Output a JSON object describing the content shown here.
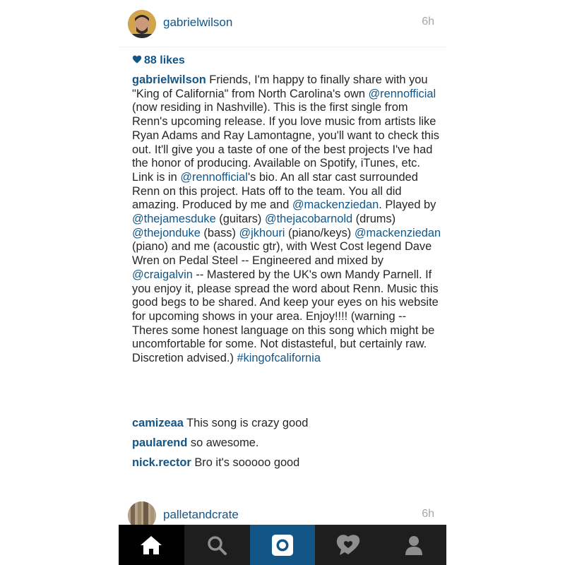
{
  "post": {
    "username": "gabrielwilson",
    "time": "6h",
    "likes": "88 likes",
    "caption_segments": [
      {
        "t": "user",
        "v": "gabrielwilson"
      },
      {
        "t": "text",
        "v": " Friends, I'm happy to finally share with you \"King of California\" from North Carolina's own "
      },
      {
        "t": "mention",
        "v": "@rennofficial"
      },
      {
        "t": "text",
        "v": " (now residing in Nashville). This is the first single from Renn's upcoming release. If you love music from artists like Ryan Adams and Ray Lamontagne, you'll want to check this out. It'll give you a taste of one of the best projects I've had the honor of producing.  Available on Spotify, iTunes, etc. Link is in "
      },
      {
        "t": "mention",
        "v": "@rennofficial"
      },
      {
        "t": "text",
        "v": "'s bio.  An all star cast surrounded Renn on this project. Hats off to the team. You all did amazing. Produced by me and "
      },
      {
        "t": "mention",
        "v": "@mackenziedan"
      },
      {
        "t": "text",
        "v": ". Played by "
      },
      {
        "t": "mention",
        "v": "@thejamesduke"
      },
      {
        "t": "text",
        "v": " (guitars) "
      },
      {
        "t": "mention",
        "v": "@thejacobarnold"
      },
      {
        "t": "text",
        "v": " (drums) "
      },
      {
        "t": "mention",
        "v": "@thejonduke"
      },
      {
        "t": "text",
        "v": " (bass) "
      },
      {
        "t": "mention",
        "v": "@jkhouri"
      },
      {
        "t": "text",
        "v": " (piano/keys) "
      },
      {
        "t": "mention",
        "v": "@mackenziedan"
      },
      {
        "t": "text",
        "v": " (piano) and me (acoustic gtr), with West Cost legend Dave Wren on Pedal Steel -- Engineered and mixed by "
      },
      {
        "t": "mention",
        "v": "@craigalvin"
      },
      {
        "t": "text",
        "v": " -- Mastered by the UK's own Mandy Parnell. If you enjoy it, please spread the word about Renn. Music this good begs to be shared. And keep your eyes on his website for upcoming shows in your area. Enjoy!!!! (warning -- Theres some honest language on this song which might be uncomfortable for some. Not distasteful, but certainly raw. Discretion advised.) "
      },
      {
        "t": "mention",
        "v": "#kingofcalifornia"
      }
    ],
    "comments": [
      {
        "user": "camizeaa",
        "text": " This song is crazy good"
      },
      {
        "user": "paularend",
        "text": " so awesome."
      },
      {
        "user": "nick.rector",
        "text": " Bro it's sooooo good"
      }
    ]
  },
  "next_post": {
    "username": "palletandcrate",
    "time": "6h"
  },
  "tabbar": {
    "icons": [
      "home-icon",
      "search-icon",
      "camera-icon",
      "activity-heart-icon",
      "profile-icon"
    ]
  },
  "colors": {
    "link": "#125688",
    "text": "#262626",
    "time": "#a5a7aa",
    "tabbar_bg": "#1e1e1e",
    "camera_tab": "#125688"
  }
}
